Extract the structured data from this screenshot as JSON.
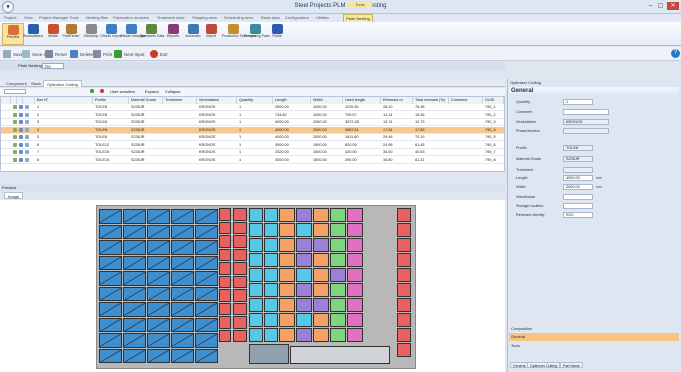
{
  "window": {
    "title": "Steel Projects PLM - Plate Nesting",
    "tools_tab": "Tools",
    "controls": [
      "–",
      "▢",
      "✕"
    ]
  },
  "menu": [
    "Project",
    "View",
    "Project Manager Tools",
    "Nesting files",
    "Fabrication modules",
    "Treatment Area",
    "Shipping area",
    "Scheduling area",
    "Basic data",
    "Configuration",
    "Utilities",
    "Plate Nesting"
  ],
  "ribbon": [
    {
      "label": "Preview",
      "color": "#d9703a"
    },
    {
      "label": "Workstations",
      "color": "#2a5db0"
    },
    {
      "label": "Nestle",
      "color": "#c8502a"
    },
    {
      "label": "PathFinder",
      "color": "#b07a30"
    },
    {
      "label": "Start/stop",
      "color": "#8a8a8a"
    },
    {
      "label": "Offcuts import",
      "color": "#3d7fc2"
    },
    {
      "label": "Offcuts manager",
      "color": "#3d7fc2"
    },
    {
      "label": "Standards Data",
      "color": "#5a8a3a"
    },
    {
      "label": "Reports",
      "color": "#8a3a7a"
    },
    {
      "label": "Automatic",
      "color": "#3a7ab5"
    },
    {
      "label": "Import",
      "color": "#c04a3a"
    },
    {
      "label": "Production Time input",
      "color": "#c09030"
    },
    {
      "label": "Remaining Parts",
      "color": "#3a8aa0"
    },
    {
      "label": "Fiddle",
      "color": "#2a5db0"
    }
  ],
  "toolbar": {
    "save": "Save",
    "save_all": "Save all",
    "reset": "Reset",
    "delete": "Delete",
    "print": "Print",
    "next_input": "Next Input",
    "exit": "Exit"
  },
  "plate_nesting": {
    "label": "Plate Nesting",
    "value": "750"
  },
  "tabs": [
    "Component",
    "Stock",
    "Optimizer Cutting"
  ],
  "grid_tools": [
    "User sensitive",
    "Expand",
    "Collapse"
  ],
  "columns": [
    "",
    "",
    "",
    "",
    "Bar N°",
    "Profile",
    "Material Grade",
    "Treatment",
    "Workstation",
    "Quantity",
    "Length",
    "Width",
    "Used length",
    "Remnant m",
    "Total remnant (%)",
    "Comment",
    "GUID"
  ],
  "rows": [
    {
      "n": "1",
      "profile": "TOLE8",
      "grade": "S235JR",
      "treatment": "",
      "workstation": "KRONOS",
      "qty": "1",
      "length": "2500.00",
      "width": "2000.00",
      "used": "1129.45",
      "remnant": "28.20",
      "total": "76.38",
      "comment": "",
      "guid": "790_1",
      "sel": false
    },
    {
      "n": "2",
      "profile": "TOLE8",
      "grade": "S235JR",
      "treatment": "",
      "workstation": "KRONOS",
      "qty": "1",
      "length": "734.82",
      "width": "2000.00",
      "used": "709.57",
      "remnant": "14.14",
      "total": "15.36",
      "comment": "",
      "guid": "790_2",
      "sel": false
    },
    {
      "n": "3",
      "profile": "TOLE8",
      "grade": "S235JR",
      "treatment": "",
      "workstation": "KRONOS",
      "qty": "1",
      "length": "4000.00",
      "width": "2000.00",
      "used": "3972.28",
      "remnant": "13.74",
      "total": "10.73",
      "comment": "",
      "guid": "790_3",
      "sel": false
    },
    {
      "n": "4",
      "profile": "TOLE8",
      "grade": "S235JR",
      "treatment": "",
      "workstation": "KRONOS",
      "qty": "1",
      "length": "4000.00",
      "width": "2000.00",
      "used": "3987.61",
      "remnant": "17.54",
      "total": "17.89",
      "comment": "",
      "guid": "790_4",
      "sel": true
    },
    {
      "n": "5",
      "profile": "TOLE8",
      "grade": "S235JR",
      "treatment": "",
      "workstation": "KRONOS",
      "qty": "1",
      "length": "4000.00",
      "width": "2000.00",
      "used": "1611.60",
      "remnant": "29.46",
      "total": "70.19",
      "comment": "",
      "guid": "790_5",
      "sel": false
    },
    {
      "n": "6",
      "profile": "TOLE12",
      "grade": "S235JR",
      "treatment": "",
      "workstation": "KRONOS",
      "qty": "1",
      "length": "3000.00",
      "width": "1500.00",
      "used": "820.05",
      "remnant": "24.98",
      "total": "61.45",
      "comment": "",
      "guid": "790_6",
      "sel": false
    },
    {
      "n": "7",
      "profile": "TOLE15",
      "grade": "S235JR",
      "treatment": "",
      "workstation": "KRONOS",
      "qty": "1",
      "length": "2320.00",
      "width": "1500.00",
      "used": "320.00",
      "remnant": "34.00",
      "total": "40.53",
      "comment": "",
      "guid": "790_7",
      "sel": false
    },
    {
      "n": "8",
      "profile": "TOLE15",
      "grade": "S235JR",
      "treatment": "",
      "workstation": "KRONOS",
      "qty": "1",
      "length": "3000.00",
      "width": "1500.00",
      "used": "290.00",
      "remnant": "16.80",
      "total": "81.21",
      "comment": "",
      "guid": "790_8",
      "sel": false
    }
  ],
  "preview": {
    "header": "Preview",
    "tab": "Image"
  },
  "right_panel": {
    "title": "Optimizer Cutting",
    "section": "General",
    "fields_top": [
      {
        "label": "Quantity",
        "value": "1"
      },
      {
        "label": "Comment",
        "value": ""
      },
      {
        "label": "Workstation",
        "value": "KRONOS"
      },
      {
        "label": "Phase/section",
        "value": ""
      }
    ],
    "fields_bottom": [
      {
        "label": "Profile",
        "value": "TOLE8",
        "unit": ""
      },
      {
        "label": "Material Grade",
        "value": "S235JR",
        "unit": ""
      },
      {
        "label": "Treatment",
        "value": "",
        "unit": ""
      },
      {
        "label": "Length",
        "value": "4000.00",
        "unit": "mm"
      },
      {
        "label": "Width",
        "value": "2000.00",
        "unit": "mm"
      },
      {
        "label": "Warehouse",
        "value": "",
        "unit": ""
      },
      {
        "label": "Storage location",
        "value": "",
        "unit": ""
      },
      {
        "label": "Remnant identity",
        "value": "SVC",
        "unit": ""
      }
    ],
    "composition": "Composition",
    "general_bar": "General",
    "tools": "Tools",
    "bottom_tabs": [
      "General",
      "Optimizer Cutting",
      "Part Name"
    ]
  },
  "nest_colors": {
    "blue": "#3e8fd0",
    "red": "#e86060",
    "cyan": "#56c8e6",
    "orange": "#f5a066",
    "violet": "#9a80d6",
    "green": "#7fd57f",
    "pink": "#e070c0",
    "grey": "#8fa0b0"
  }
}
